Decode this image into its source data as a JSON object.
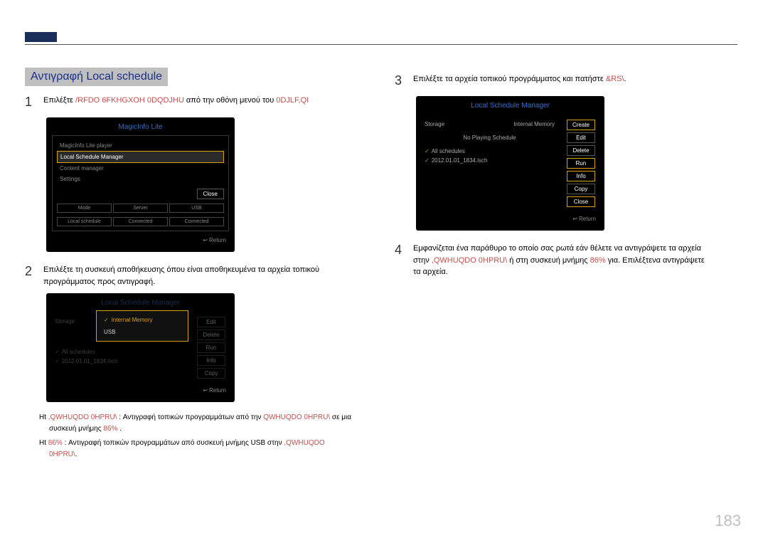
{
  "section_title": "Αντιγραφή Local schedule",
  "page_number": "183",
  "steps": {
    "s1": {
      "num": "1",
      "prefix": "Επιλέξτε ",
      "red1": "/RFDO 6FKHGXOH 0DQDJHU",
      "mid": " από την οθόνη μενού του ",
      "red2": "0DJLF,QI"
    },
    "s2": {
      "num": "2",
      "text": "Επιλέξτε τη συσκευή αποθήκευσης όπου είναι αποθηκευμένα τα αρχεία τοπικού προγράμματος προς αντιγραφή."
    },
    "s3": {
      "num": "3",
      "prefix": "Επιλέξτε τα αρχεία τοπικού προγράμματος και πατήστε ",
      "red": "&RS\\"
    },
    "s4": {
      "num": "4",
      "l1a": "Εμφανίζεται ένα παράθυρο το οποίο σας ρωτά εάν θέλετε να αντιγράψετε τα αρχεία",
      "l2a": "στην ",
      "red1": ",QWHUQDO 0HPRU\\",
      "l2b": " ή στη συσκευή μνήμης ",
      "red2": "86%",
      "l2c": "για. Επιλέξτενα αντιγράψετε",
      "l3": "τα αρχεία."
    }
  },
  "mock1": {
    "title": "MagicInfo Lite",
    "items": [
      "MagicInfo Lite player",
      "Local Schedule Manager",
      "Content manager",
      "Settings"
    ],
    "close": "Close",
    "grid_h": [
      "Mode",
      "Server",
      "USB"
    ],
    "grid_v": [
      "Local schedule",
      "Connected",
      "Connected"
    ],
    "ret": "Return"
  },
  "mock2": {
    "title": "Local Schedule Manager",
    "storage": "Storage",
    "internal": "Internal Memory",
    "noplay": "No Playing Schedule",
    "all": "All schedules",
    "file": "2012.01.01_1834.lsch",
    "btns": [
      "Create",
      "Edit",
      "Delete",
      "Run",
      "Info",
      "Copy",
      "Close"
    ],
    "ret": "Return"
  },
  "mock3": {
    "title": "Local Schedule Manager",
    "popup": [
      "Internal Memory",
      "USB"
    ],
    "file": "2012.01.01_1834.lsch",
    "btns": [
      "Edit",
      "Delete",
      "Run",
      "Info",
      "Copy"
    ],
    "ret": "Return"
  },
  "notes": {
    "n1a": "Ht ",
    "n1r1": ",QWHUQDO 0HPRU\\",
    "n1b": ": Αντιγραφή τοπικών προγραμμάτων από την",
    "n1r2": "QWHUQDO 0HPRU\\",
    "n1c": " σε μια",
    "n1d": "συσκευή μνήμης ",
    "n1r3": "86%",
    "n1e": ".",
    "n2a": "Ht ",
    "n2r1": "86%",
    "n2b": ": Αντιγραφή τοπικών προγραμμάτων από συσκευή μνήμης USB στην ",
    "n2r2": ",QWHUQDO",
    "n2r3": "0HPRU\\"
  }
}
